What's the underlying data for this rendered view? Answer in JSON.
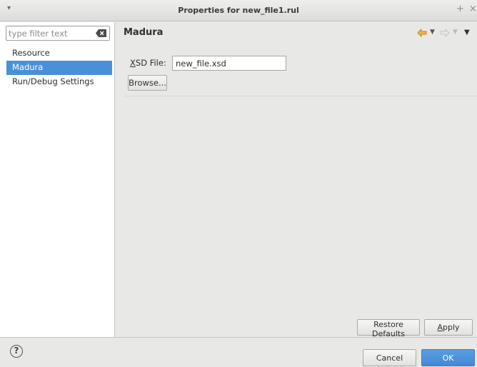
{
  "window": {
    "title": "Properties for new_file1.rul",
    "menu_glyph": "▾",
    "maximize_glyph": "+",
    "close_glyph": "×"
  },
  "sidebar": {
    "filter": {
      "placeholder": "type filter text",
      "value": ""
    },
    "items": [
      {
        "label": "Resource",
        "selected": false
      },
      {
        "label": "Madura",
        "selected": true
      },
      {
        "label": "Run/Debug Settings",
        "selected": false
      }
    ]
  },
  "page": {
    "title": "Madura",
    "xsd_label_mnemonic": "X",
    "xsd_label_rest": "SD File:",
    "xsd_value": "new_file.xsd",
    "browse_label": "Browse...",
    "restore_label_pre": "Restore ",
    "restore_label_mnemonic": "D",
    "restore_label_post": "efaults",
    "apply_label_mnemonic": "A",
    "apply_label_post": "pply"
  },
  "footer": {
    "help_glyph": "?",
    "cancel_label": "Cancel",
    "ok_label": "OK"
  },
  "colors": {
    "accent": "#4a90d9",
    "nav_back": "#e8a33c",
    "nav_disabled": "#c8c8c8"
  },
  "icons": {
    "nav_back": "arrow-left-icon",
    "nav_forward": "arrow-right-icon",
    "filter_clear": "clear-icon",
    "help": "help-icon"
  }
}
